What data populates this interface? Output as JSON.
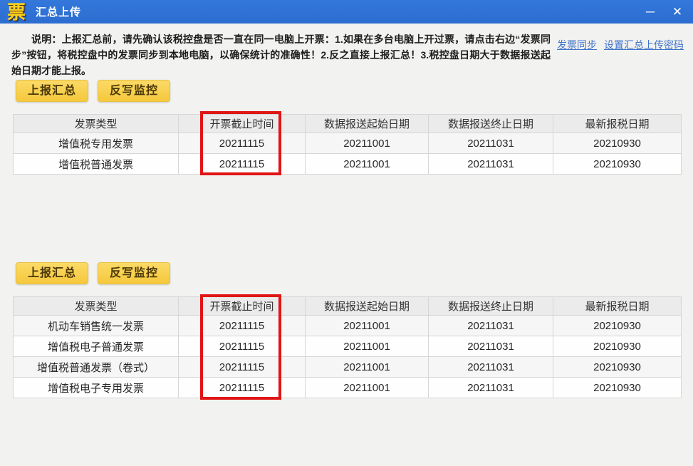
{
  "window": {
    "logo_glyph": "票",
    "title": "汇总上传",
    "minimize_glyph": "─",
    "close_glyph": "✕"
  },
  "note": {
    "text": "说明：上报汇总前，请先确认该税控盘是否一直在同一电脑上开票：1.如果在多台电脑上开过票，请点击右边“发票同步”按钮，将税控盘中的发票同步到本地电脑，以确保统计的准确性！2.反之直接上报汇总！3.税控盘日期大于数据报送起始日期才能上报。"
  },
  "links": {
    "invoice_sync": "发票同步",
    "set_upload_password": "设置汇总上传密码"
  },
  "buttons": {
    "report_summary": "上报汇总",
    "writeback_monitor": "反写监控"
  },
  "table_headers": [
    "发票类型",
    "开票截止时间",
    "数据报送起始日期",
    "数据报送终止日期",
    "最新报税日期"
  ],
  "table1": {
    "rows": [
      [
        "增值税专用发票",
        "20211115",
        "20211001",
        "20211031",
        "20210930"
      ],
      [
        "增值税普通发票",
        "20211115",
        "20211001",
        "20211031",
        "20210930"
      ]
    ]
  },
  "table2": {
    "rows": [
      [
        "机动车销售统一发票",
        "20211115",
        "20211001",
        "20211031",
        "20210930"
      ],
      [
        "增值税电子普通发票",
        "20211115",
        "20211001",
        "20211031",
        "20210930"
      ],
      [
        "增值税普通发票（卷式）",
        "20211115",
        "20211001",
        "20211031",
        "20210930"
      ],
      [
        "增值税电子专用发票",
        "20211115",
        "20211001",
        "20211031",
        "20210930"
      ]
    ]
  },
  "colors": {
    "titlebar_blue": "#2e72d3",
    "button_yellow": "#f8cf4e",
    "link_blue": "#3f74c8",
    "highlight_red": "#e01515"
  }
}
